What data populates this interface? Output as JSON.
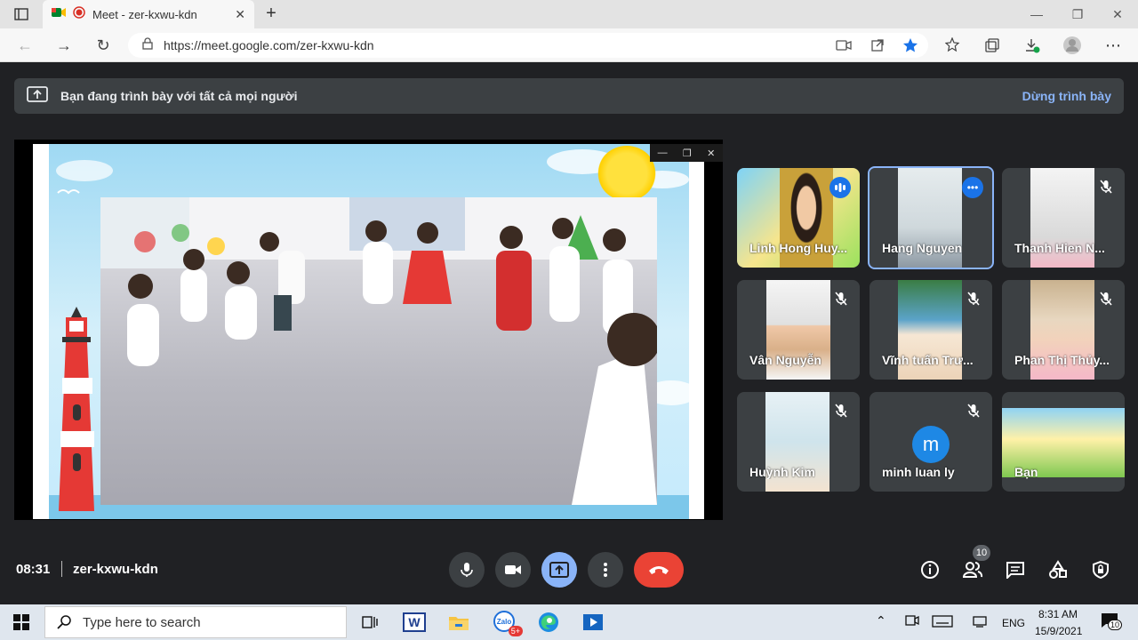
{
  "browser": {
    "tab_title": "Meet - zer-kxwu-kdn",
    "url": "https://meet.google.com/zer-kxwu-kdn"
  },
  "banner": {
    "message": "Bạn đang trình bày với tất cả mọi người",
    "stop_label": "Dừng trình bày"
  },
  "participants": [
    {
      "name": "Linh Hong Huy...",
      "state": "speaking"
    },
    {
      "name": "Hang Nguyen",
      "state": "more-options"
    },
    {
      "name": "Thanh Hien N...",
      "state": "muted"
    },
    {
      "name": "Vân Nguyễn",
      "state": "muted"
    },
    {
      "name": "Vĩnh tuấn Trư...",
      "state": "muted"
    },
    {
      "name": "Phan Thị Thủy...",
      "state": "muted"
    },
    {
      "name": "Huỳnh Kim",
      "state": "muted"
    },
    {
      "name": "minh luan ly",
      "initial": "m",
      "state": "muted"
    },
    {
      "name": "Bạn",
      "state": "self"
    }
  ],
  "meeting": {
    "time": "08:31",
    "code": "zer-kxwu-kdn",
    "participant_count": "10"
  },
  "taskbar": {
    "search_placeholder": "Type here to search",
    "language": "ENG",
    "time": "8:31 AM",
    "date": "15/9/2021",
    "notification_count": "10",
    "zalo_badge": "5+"
  },
  "colors": {
    "meet_bg": "#202124",
    "accent": "#8ab4f8",
    "end_call": "#ea4335",
    "tile_bg": "#3c4043"
  }
}
